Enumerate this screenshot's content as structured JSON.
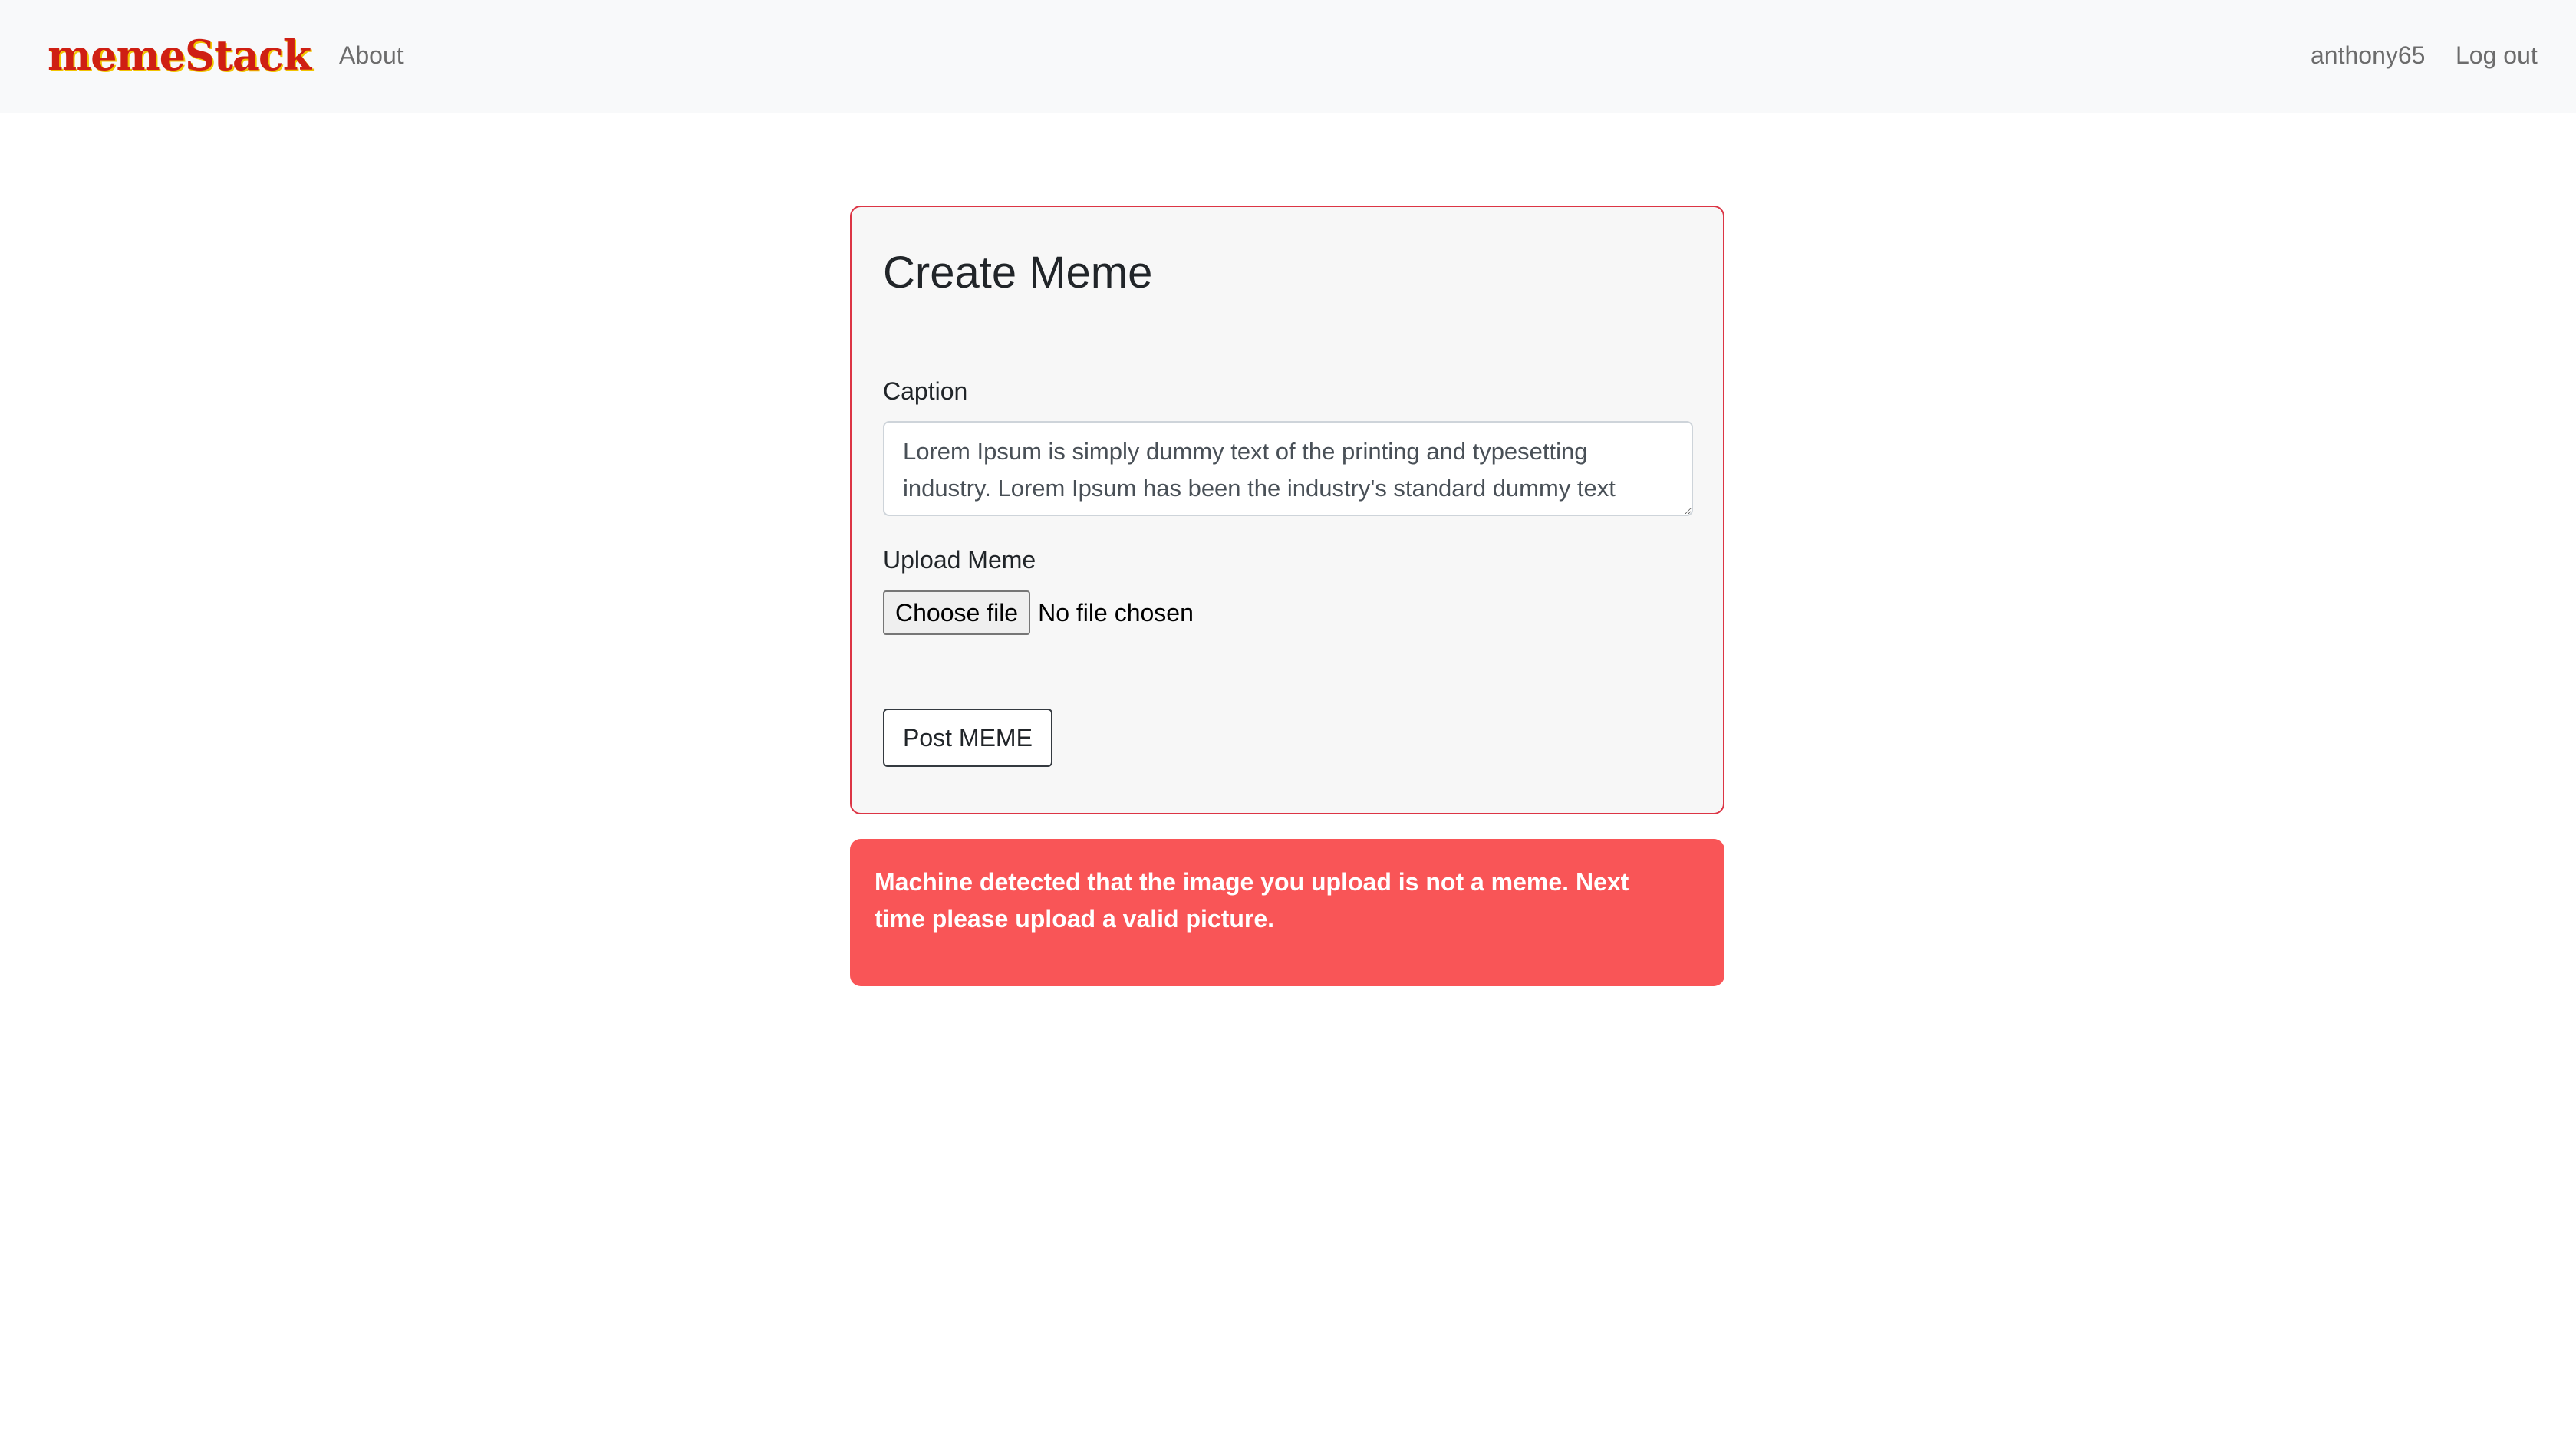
{
  "navbar": {
    "brand": "memeStack",
    "about_label": "About",
    "username": "anthony65",
    "logout_label": "Log out"
  },
  "form": {
    "title": "Create Meme",
    "caption_label": "Caption",
    "caption_value": "Lorem Ipsum is simply dummy text of the printing and typesetting industry. Lorem Ipsum has been the industry's standard dummy text",
    "upload_label": "Upload Meme",
    "file_button_label": "Choose file",
    "file_status": "No file chosen",
    "submit_label": "Post MEME"
  },
  "alert": {
    "message": "Machine detected that the image you upload is not a meme. Next time please upload a valid picture."
  },
  "colors": {
    "brand": "#cf1f13",
    "brand_shadow": "#f2c500",
    "card_border": "#dc3545",
    "alert_background": "#f95557"
  }
}
